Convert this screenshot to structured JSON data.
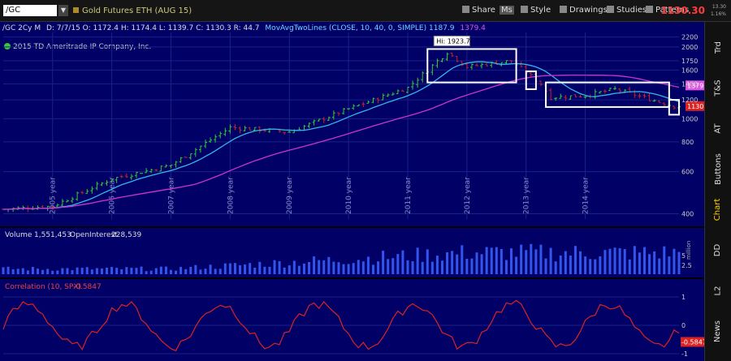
{
  "toolbar": {
    "symbol": "/GC",
    "symbol_name": "Gold Futures ETH (AUG 15)",
    "buttons": [
      "Share",
      "Ms",
      "Style",
      "Drawings",
      "Studies",
      "Patterns"
    ],
    "last_price": "1130.30",
    "mini": [
      "13.30",
      "1.16%"
    ]
  },
  "info_bar": {
    "aggregation": "/GC 2Cy M",
    "values": "D: 7/7/15   O: 1172.4   H: 1174.4   L: 1139.7   C: 1130.3   R: 44.7",
    "study_name": "MovAvgTwoLines (CLOSE, 10, 40, 0, SIMPLE)",
    "study_val1": "1187.9",
    "study_val2": "1379.4"
  },
  "copyright": "2015 TD Ameritrade IP Company, Inc.",
  "colors": {
    "background": "#000066",
    "up_bar": "#33cc33",
    "down_bar": "#cc2222",
    "fast_ma": "#33b8e6",
    "slow_ma": "#cc33cc",
    "volume": "#3355ee",
    "correlation": "#dd2222",
    "annotation_box": "#ffffff"
  },
  "chart_data": [
    {
      "type": "candlestick",
      "title": "Gold Futures ETH (AUG 15)",
      "y_scale": "log",
      "y_ticks": [
        "2200",
        "2000",
        "1750",
        "1600",
        "1400",
        "1200",
        "1000",
        "800",
        "600",
        "400"
      ],
      "x_ticks": [
        "2005 year",
        "2006 year",
        "2007 year",
        "2008 year",
        "2009 year",
        "2010 year",
        "2011 year",
        "2012 year",
        "2013 year",
        "2014 year"
      ],
      "annotations": {
        "high_label": "Hi: 1923.7",
        "ma_slow_label": "1379.4",
        "last_label": "1130.3"
      },
      "key_points": {
        "x": [
          "2004-01",
          "2005-01",
          "2006-01",
          "2007-01",
          "2008-01",
          "2009-01",
          "2010-01",
          "2011-01",
          "2011-09",
          "2012-01",
          "2012-10",
          "2013-04",
          "2013-06",
          "2014-01",
          "2014-07",
          "2015-07"
        ],
        "close": [
          415,
          430,
          560,
          640,
          920,
          880,
          1100,
          1350,
          1900,
          1650,
          1750,
          1400,
          1230,
          1250,
          1330,
          1130
        ]
      },
      "series": [
        {
          "name": "MovAvgTwoLines fast (10)",
          "last": 1187.9
        },
        {
          "name": "MovAvgTwoLines slow (40)",
          "last": 1379.4
        }
      ],
      "boxes": [
        "2011-2012 top",
        "2013 breakdown",
        "2013-2015 range",
        "last price"
      ]
    },
    {
      "type": "bar",
      "title": "Volume",
      "values_text": {
        "volume": "1,551,453",
        "open_interest_label": "OpenInterest",
        "open_interest": "228,539"
      },
      "y_ticks": [
        "5",
        "2.5"
      ],
      "unit_label": "million"
    },
    {
      "type": "line",
      "title": "Correlation (10, SPX)",
      "last_value": "-0.5847",
      "ylim": [
        -1,
        1
      ],
      "y_ticks": [
        "1",
        "0",
        "-1"
      ]
    }
  ],
  "sidebar_tabs": [
    "Trd",
    "T&S",
    "AT",
    "Buttons",
    "Chart",
    "DD",
    "L2",
    "News"
  ],
  "sidebar_active": "Chart"
}
